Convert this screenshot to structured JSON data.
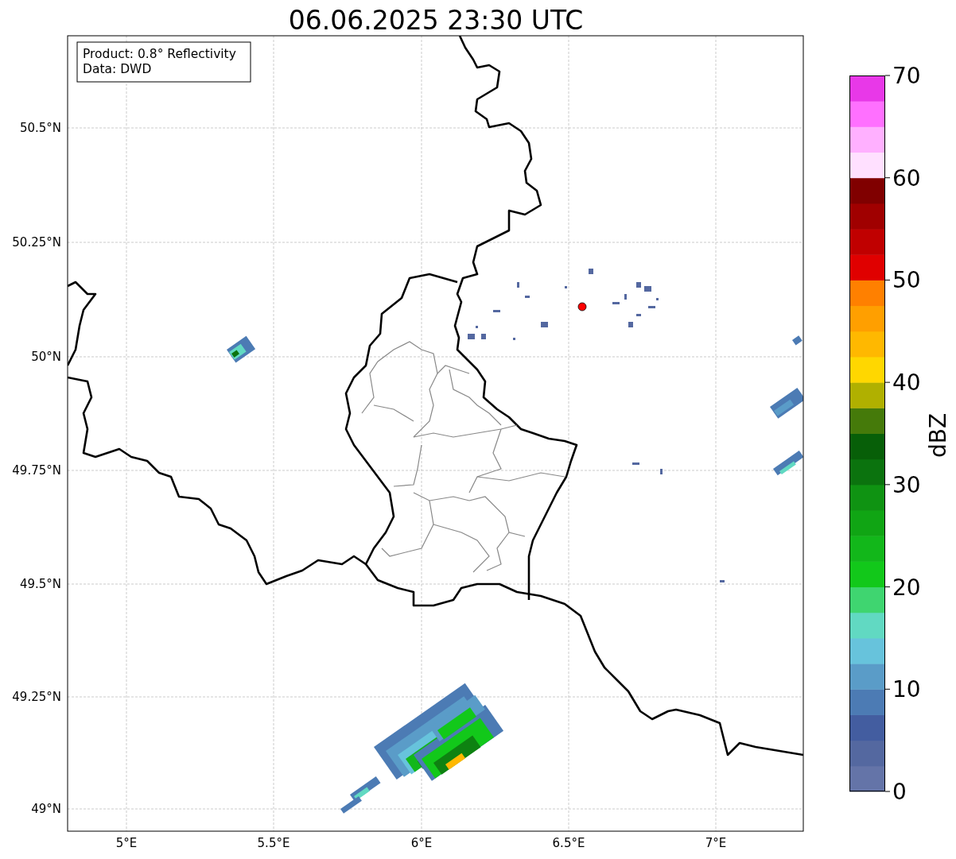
{
  "title": "06.06.2025 23:30 UTC",
  "info_box": [
    "Product: 0.8° Reflectivity",
    "Data: DWD"
  ],
  "y_ticks": [
    "50.5°N",
    "50.25°N",
    "50°N",
    "49.75°N",
    "49.5°N",
    "49.25°N",
    "49°N"
  ],
  "x_ticks": [
    "5°E",
    "5.5°E",
    "6°E",
    "6.5°E",
    "7°E"
  ],
  "colorbar": {
    "label": "dBZ",
    "ticks": [
      "70",
      "60",
      "50",
      "40",
      "30",
      "20",
      "10",
      "0"
    ]
  }
}
